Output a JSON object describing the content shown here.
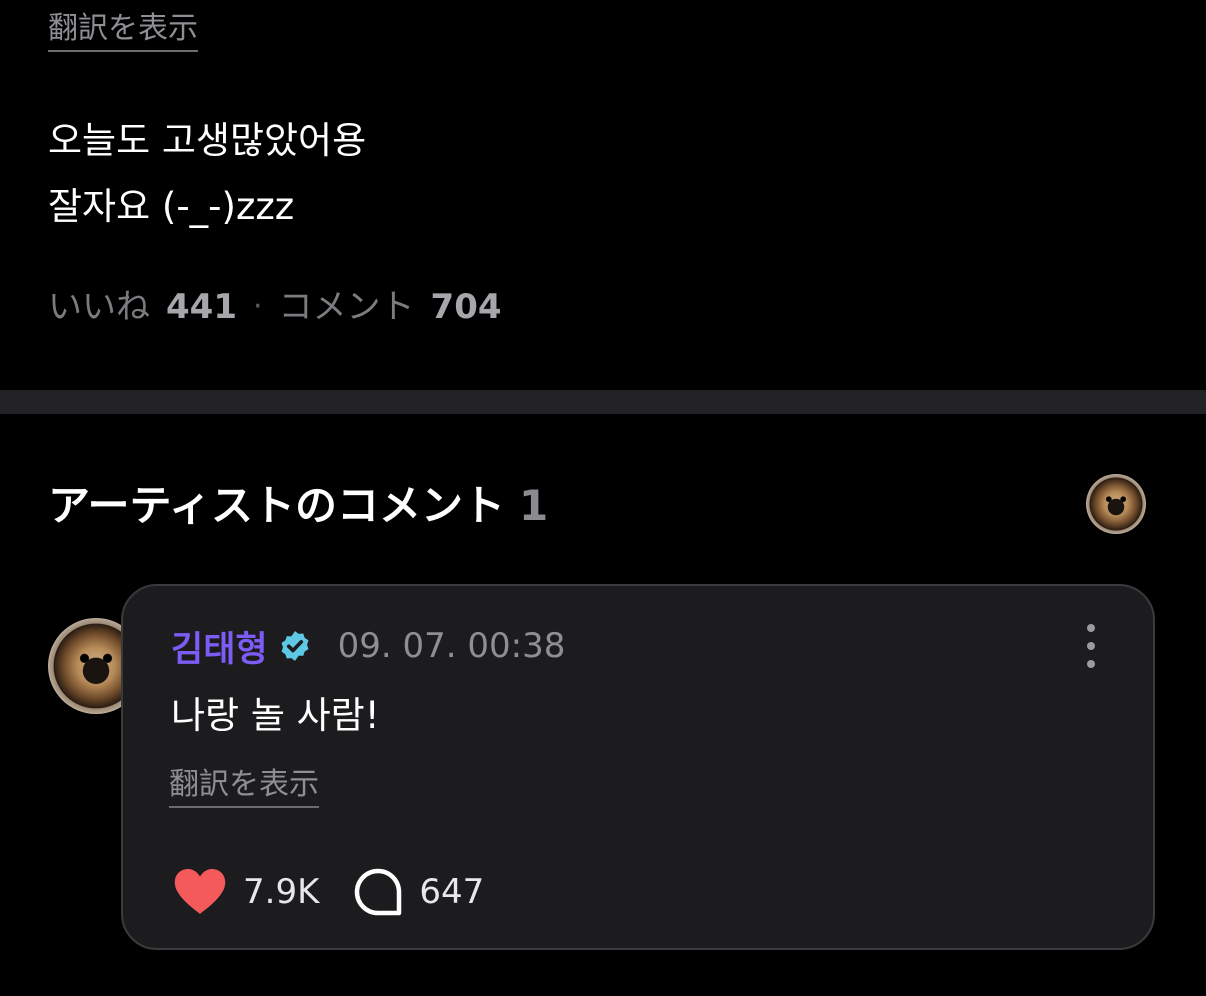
{
  "post": {
    "translate_label": "翻訳を表示",
    "body_lines": [
      "오늘도 고생많았어용",
      "잘자요 (-_-)zzz"
    ],
    "likes_label": "いいね",
    "likes_count": "441",
    "separator": "·",
    "comments_label": "コメント",
    "comments_count": "704"
  },
  "artist_comments": {
    "title": "アーティストのコメント",
    "count": "1",
    "header_avatar_icon": "pomeranian-avatar"
  },
  "comment": {
    "author": "김태형",
    "author_color": "#7c5cf5",
    "verified_icon": "verified-badge-icon",
    "verified_color": "#5ec8e6",
    "timestamp": "09. 07. 00:38",
    "text": "나랑 놀 사람!",
    "translate_label": "翻訳を表示",
    "like_icon": "heart-icon",
    "like_color": "#f55a5a",
    "like_count": "7.9K",
    "reply_icon": "comment-bubble-icon",
    "reply_count": "647",
    "more_icon": "more-vertical-icon"
  }
}
